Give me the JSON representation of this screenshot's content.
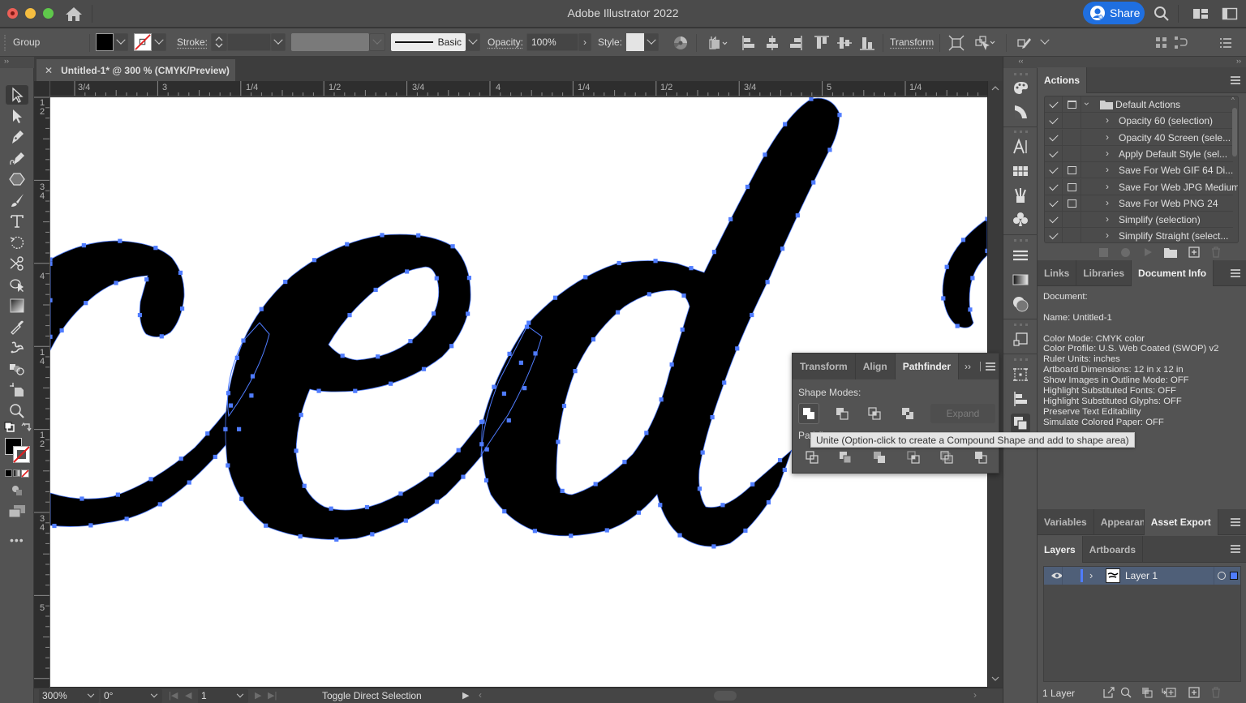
{
  "window": {
    "title": "Adobe Illustrator 2022",
    "share_label": "Share"
  },
  "control_bar": {
    "selection_type": "Group",
    "fill_color": "#000000",
    "stroke_label": "Stroke:",
    "stroke_weight": "",
    "brush_label": "Basic",
    "opacity_label": "Opacity:",
    "opacity_value": "100%",
    "style_label": "Style:",
    "transform_label": "Transform"
  },
  "document": {
    "tab_title": "Untitled-1* @ 300 % (CMYK/Preview)",
    "ruler_top_labels": [
      "3/4",
      "3",
      "1/4",
      "1/2",
      "3/4",
      "4",
      "1/4",
      "1/2",
      "3/4",
      "5",
      "1/4"
    ],
    "ruler_left_labels": [
      "1/2",
      "3/4",
      "4",
      "1/4",
      "1/2",
      "3/4",
      "5"
    ],
    "artwork_text": "ced"
  },
  "status_bar": {
    "zoom": "300%",
    "rotation": "0°",
    "artboard": "1",
    "message": "Toggle Direct Selection"
  },
  "tools": [
    "selection",
    "direct-selection",
    "pen",
    "curvature",
    "shape",
    "paintbrush",
    "type",
    "rotate",
    "scissors",
    "shape-builder",
    "gradient",
    "eyedropper",
    "puppet-warp",
    "blend",
    "artboard",
    "zoom"
  ],
  "actions_panel": {
    "tab": "Actions",
    "set_name": "Default Actions",
    "items": [
      {
        "label": "Opacity 60 (selection)",
        "checked": true,
        "dialog": false
      },
      {
        "label": "Opacity 40 Screen (sele...",
        "checked": true,
        "dialog": false
      },
      {
        "label": "Apply Default Style (sel...",
        "checked": true,
        "dialog": false
      },
      {
        "label": "Save For Web GIF 64 Di...",
        "checked": true,
        "dialog": true
      },
      {
        "label": "Save For Web JPG Medium",
        "checked": true,
        "dialog": true
      },
      {
        "label": "Save For Web PNG 24",
        "checked": true,
        "dialog": true
      },
      {
        "label": "Simplify (selection)",
        "checked": true,
        "dialog": false
      },
      {
        "label": "Simplify Straight (select...",
        "checked": true,
        "dialog": false
      }
    ]
  },
  "info_panel": {
    "tabs": [
      "Links",
      "Libraries",
      "Document Info"
    ],
    "active_tab": "Document Info",
    "lines": [
      "Document:",
      "",
      "Name: Untitled-1",
      "",
      "Color Mode: CMYK color",
      "Color Profile: U.S. Web Coated (SWOP) v2",
      "Ruler Units: inches",
      "Artboard Dimensions: 12 in x 12 in",
      "Show Images in Outline Mode: OFF",
      "Highlight Substituted Fonts: OFF",
      "Highlight Substituted Glyphs: OFF",
      "Preserve Text Editability",
      "Simulate Colored Paper: OFF"
    ]
  },
  "asset_panel": {
    "tabs": [
      "Variables",
      "Appearance",
      "Asset Export"
    ],
    "active_tab": "Asset Export"
  },
  "layers_panel": {
    "tabs": [
      "Layers",
      "Artboards"
    ],
    "active_tab": "Layers",
    "layers": [
      {
        "name": "Layer 1",
        "color": "#4f7cff",
        "visible": true
      }
    ],
    "count_label": "1 Layer"
  },
  "pathfinder_panel": {
    "tabs": [
      "Transform",
      "Align",
      "Pathfinder"
    ],
    "active_tab": "Pathfinder",
    "shape_modes_label": "Shape Modes:",
    "pathfinders_label": "Pathfinders:",
    "expand_label": "Expand",
    "tooltip": "Unite (Option-click to create a Compound Shape and add to shape area)"
  },
  "colors": {
    "accent": "#1f6fe0",
    "anchor": "#4f7cff",
    "layer_highlight": "#4f5f78"
  }
}
